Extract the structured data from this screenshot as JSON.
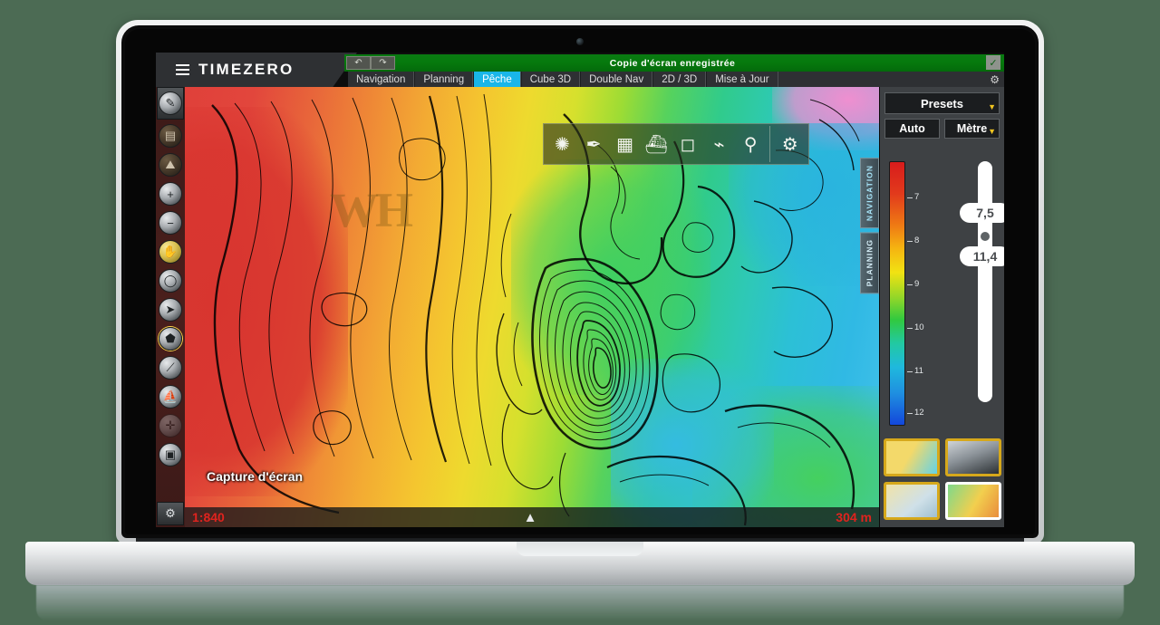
{
  "app": {
    "brand": "TIMEZERO",
    "menu_icon": "hamburger-icon"
  },
  "notification": {
    "message": "Copie d'écran enregistrée",
    "undo_label": "↶",
    "redo_label": "↷",
    "end_icon": "check-icon"
  },
  "tabs": [
    {
      "label": "Navigation",
      "active": false
    },
    {
      "label": "Planning",
      "active": false
    },
    {
      "label": "Pêche",
      "active": true
    },
    {
      "label": "Cube 3D",
      "active": false
    },
    {
      "label": "Double Nav",
      "active": false
    },
    {
      "label": "2D / 3D",
      "active": false
    },
    {
      "label": "Mise à Jour",
      "active": false
    }
  ],
  "tabbar_extra_icon": "gears-icon",
  "left_toolbar": {
    "items": [
      {
        "name": "pen-eraser-icon",
        "glyph": "✎"
      },
      {
        "name": "layers-icon",
        "glyph": "▤"
      },
      {
        "name": "terrain-icon",
        "glyph": "⛰"
      },
      {
        "name": "zoom-in-icon",
        "glyph": "+"
      },
      {
        "name": "zoom-out-icon",
        "glyph": "−"
      },
      {
        "name": "pan-hand-icon",
        "glyph": "✋"
      },
      {
        "name": "target-circle-icon",
        "glyph": "◯"
      },
      {
        "name": "cursor-arrow-icon",
        "glyph": "➤"
      },
      {
        "name": "shape-select-icon",
        "glyph": "⬟"
      },
      {
        "name": "measure-ruler-icon",
        "glyph": "⟋"
      },
      {
        "name": "route-boat-icon",
        "glyph": "⛵"
      },
      {
        "name": "crosshair-icon",
        "glyph": "✛"
      },
      {
        "name": "screenshot-camera-icon",
        "glyph": "📷"
      }
    ],
    "settings_icon": "gear-lock-icon",
    "settings_glyph": "⚙"
  },
  "map_toolbar": {
    "items": [
      {
        "name": "compass-rose-icon",
        "glyph": "✺"
      },
      {
        "name": "pen-print-icon",
        "glyph": "✒"
      },
      {
        "name": "chart-map-icon",
        "glyph": "▦"
      },
      {
        "name": "sonar-echo-icon",
        "glyph": "⛴"
      },
      {
        "name": "area-timer-icon",
        "glyph": "◻"
      },
      {
        "name": "boat-track-icon",
        "glyph": "⌁"
      },
      {
        "name": "waypoints-route-icon",
        "glyph": "⚲"
      },
      {
        "name": "settings-gears-icon",
        "glyph": "⚙"
      }
    ]
  },
  "side_tabs": [
    {
      "label": "NAVIGATION"
    },
    {
      "label": "PLANNING"
    }
  ],
  "map": {
    "watermark": "WH",
    "capture_tooltip": "Capture d'écran",
    "scale_ratio": "1:840",
    "scale_distance": "304 m",
    "north_glyph": "▲"
  },
  "right_panel": {
    "presets_label": "Presets",
    "auto_label": "Auto",
    "unit_label": "Mètre",
    "caret_glyph": "▼",
    "slider_upper_value": "7,5",
    "slider_lower_value": "11,4",
    "depth_ticks": [
      "7",
      "8",
      "9",
      "10",
      "11",
      "12"
    ],
    "thumbnails": [
      {
        "name": "thumb-vector-chart",
        "selected": false
      },
      {
        "name": "thumb-satellite-relief",
        "selected": false
      },
      {
        "name": "thumb-contour-chart",
        "selected": false
      },
      {
        "name": "thumb-bathy-chart",
        "selected": true
      }
    ]
  },
  "colors": {
    "accent_tab": "#19b6e8",
    "notification_green": "#067a0d",
    "caret_yellow": "#f0c420",
    "scale_red": "#e0231e",
    "thumb_border": "#d6a81b",
    "background": "#4c6b54"
  },
  "chart_data": {
    "type": "heatmap",
    "title": "Bathymetric depth chart (Pêche)",
    "unit": "Mètre",
    "colorbar_ticks": [
      7,
      8,
      9,
      10,
      11,
      12
    ],
    "range_min": "7,5",
    "range_max": "11,4",
    "colormap": "red-orange-yellow-green-cyan-blue (shallow to deep)",
    "scale_ratio": "1:840",
    "scale_distance_m": 304
  }
}
